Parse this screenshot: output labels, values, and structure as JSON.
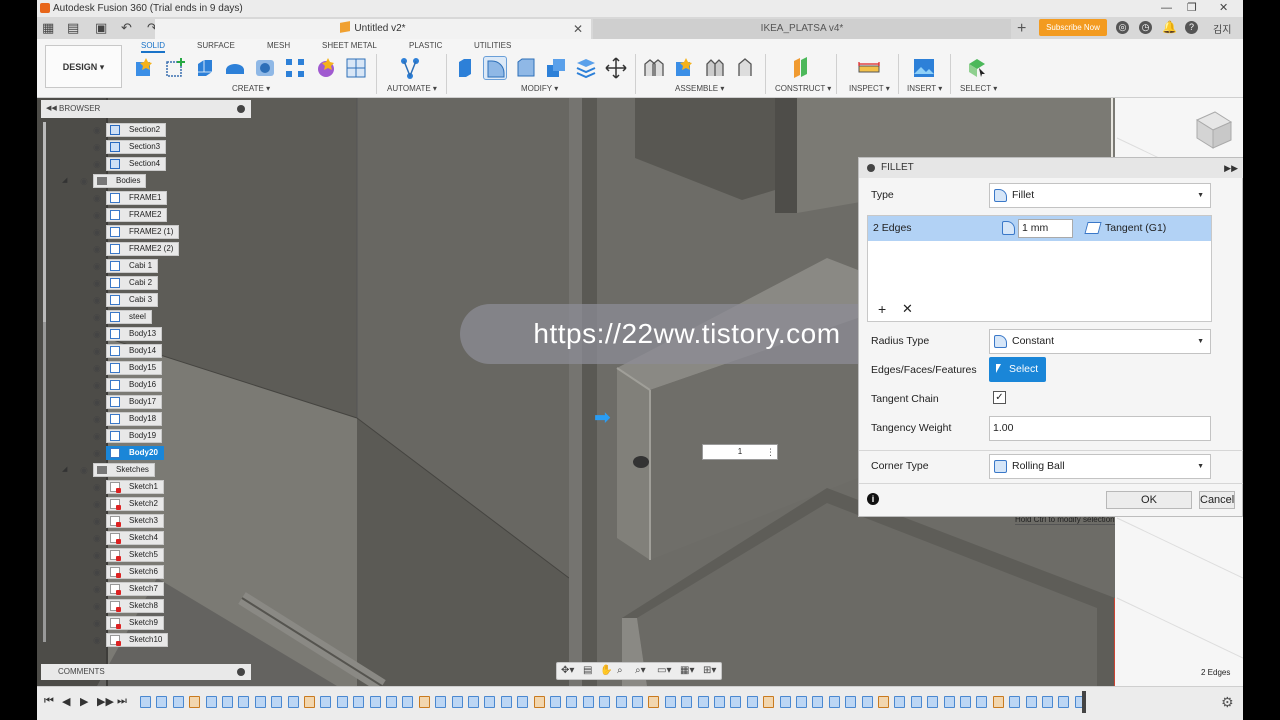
{
  "window": {
    "title": "Autodesk Fusion 360 (Trial ends in 9 days)"
  },
  "tabs": {
    "active": "Untitled v2*",
    "inactive": "IKEA_PLATSA v4*"
  },
  "topbar": {
    "subscribe": "Subscribe Now",
    "user": "김지"
  },
  "ribbon": {
    "workspace": "DESIGN ▾",
    "tabs": [
      "SOLID",
      "SURFACE",
      "MESH",
      "SHEET METAL",
      "PLASTIC",
      "UTILITIES"
    ],
    "groups": [
      "CREATE ▾",
      "AUTOMATE ▾",
      "MODIFY ▾",
      "ASSEMBLE ▾",
      "CONSTRUCT ▾",
      "INSPECT ▾",
      "INSERT ▾",
      "SELECT ▾"
    ]
  },
  "browser": {
    "title": "BROWSER",
    "items": [
      "Section2",
      "Section3",
      "Section4",
      "Bodies",
      "FRAME1",
      "FRAME2",
      "FRAME2 (1)",
      "FRAME2 (2)",
      "Cabi 1",
      "Cabi 2",
      "Cabi 3",
      "steel",
      "Body13",
      "Body14",
      "Body15",
      "Body16",
      "Body17",
      "Body18",
      "Body19",
      "Body20",
      "Sketches",
      "Sketch1",
      "Sketch2",
      "Sketch3",
      "Sketch4",
      "Sketch5",
      "Sketch6",
      "Sketch7",
      "Sketch8",
      "Sketch9",
      "Sketch10"
    ],
    "selected": "Body20"
  },
  "comments": "COMMENTS",
  "viewport": {
    "watermark": "https://22ww.tistory.com",
    "inline_value": "1",
    "hint": "Hold Ctrl to modify selection",
    "status": "2 Edges"
  },
  "fillet": {
    "title": "FILLET",
    "type_label": "Type",
    "type_value": "Fillet",
    "edges_label": "2 Edges",
    "radius": "1 mm",
    "continuity": "Tangent (G1)",
    "radius_type_label": "Radius Type",
    "radius_type_value": "Constant",
    "select_label": "Edges/Faces/Features",
    "select_button": "Select",
    "tangent_chain_label": "Tangent Chain",
    "tangent_chain_checked": "✓",
    "tangency_weight_label": "Tangency Weight",
    "tangency_weight_value": "1.00",
    "corner_type_label": "Corner Type",
    "corner_type_value": "Rolling Ball",
    "ok": "OK",
    "cancel": "Cancel"
  },
  "colors": {
    "accent": "#1a86d8",
    "selected_row": "#b2d2f5",
    "subscribe": "#f39b20"
  }
}
